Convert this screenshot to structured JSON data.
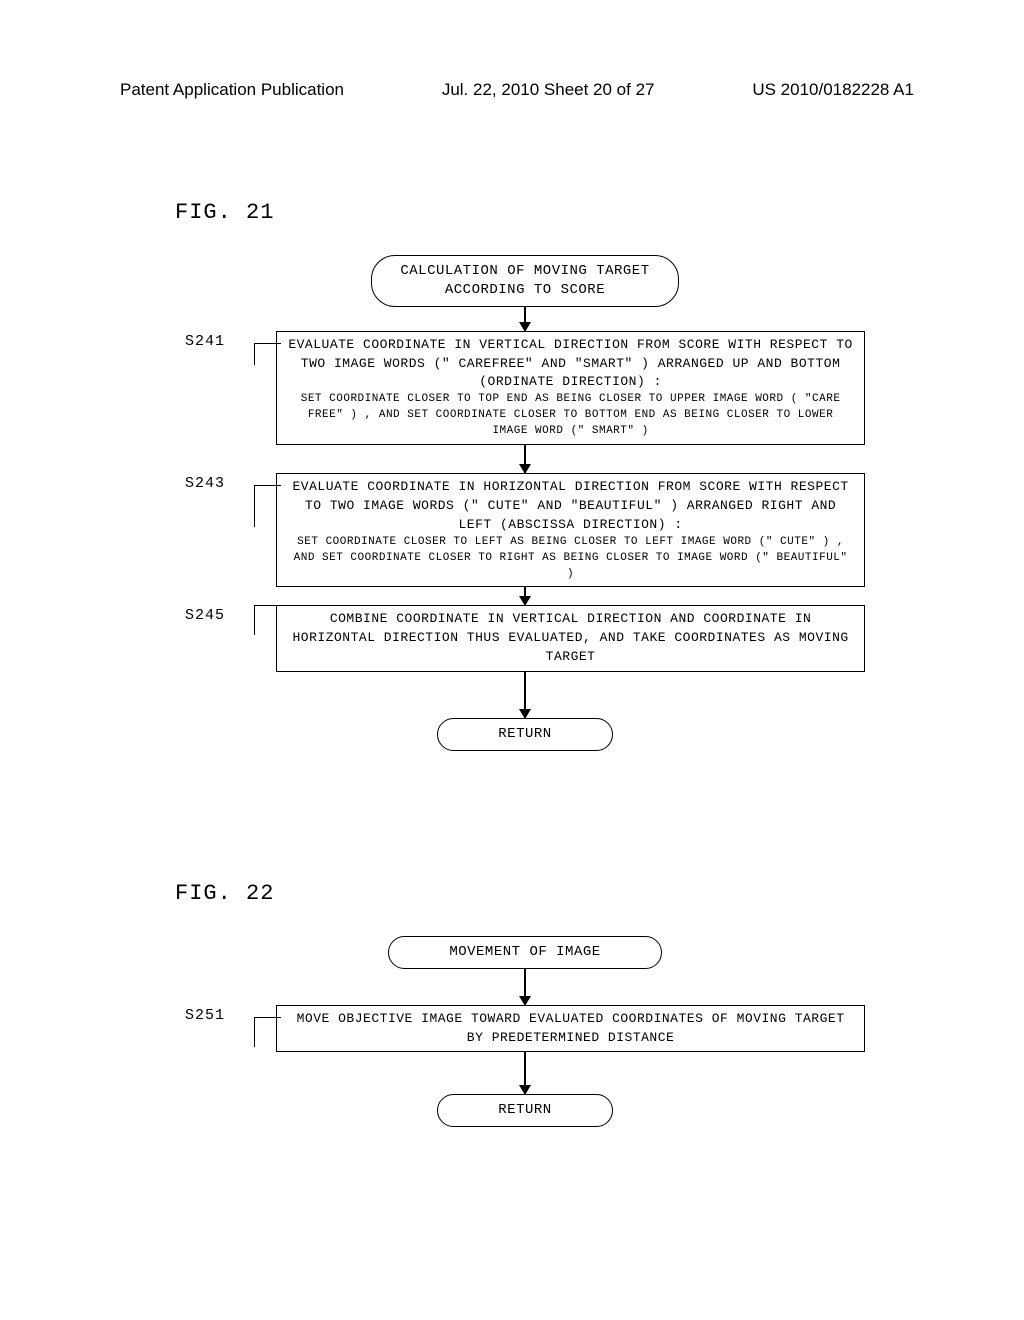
{
  "header": {
    "left": "Patent Application Publication",
    "center": "Jul. 22, 2010  Sheet 20 of 27",
    "right": "US 2010/0182228 A1"
  },
  "fig21": {
    "label": "FIG. 21",
    "start": "CALCULATION OF MOVING TARGET\nACCORDING TO SCORE",
    "steps": {
      "s241": {
        "num": "S241",
        "main": "EVALUATE COORDINATE IN VERTICAL DIRECTION FROM SCORE WITH RESPECT TO TWO IMAGE WORDS (\" CAREFREE\" AND \"SMART\" ) ARRANGED UP AND BOTTOM (ORDINATE DIRECTION) :",
        "sub": "SET COORDINATE CLOSER TO TOP END AS BEING CLOSER TO UPPER IMAGE WORD ( \"CARE FREE\" ) , AND SET COORDINATE CLOSER TO BOTTOM END AS BEING CLOSER TO LOWER IMAGE WORD (\" SMART\" )"
      },
      "s243": {
        "num": "S243",
        "main": "EVALUATE COORDINATE IN HORIZONTAL DIRECTION FROM SCORE WITH RESPECT TO TWO IMAGE WORDS (\" CUTE\" AND \"BEAUTIFUL\" ) ARRANGED RIGHT AND LEFT (ABSCISSA DIRECTION) :",
        "sub": "SET COORDINATE CLOSER TO LEFT AS BEING CLOSER TO LEFT IMAGE WORD (\" CUTE\" ) , AND SET COORDINATE CLOSER TO RIGHT AS BEING CLOSER TO IMAGE WORD (\" BEAUTIFUL\" )"
      },
      "s245": {
        "num": "S245",
        "main": "COMBINE COORDINATE IN VERTICAL DIRECTION AND COORDINATE IN HORIZONTAL DIRECTION THUS EVALUATED, AND TAKE COORDINATES AS MOVING TARGET"
      }
    },
    "return": "RETURN"
  },
  "fig22": {
    "label": "FIG. 22",
    "start": "MOVEMENT OF IMAGE",
    "steps": {
      "s251": {
        "num": "S251",
        "main": "MOVE OBJECTIVE IMAGE TOWARD EVALUATED COORDINATES OF MOVING TARGET BY PREDETERMINED DISTANCE"
      }
    },
    "return": "RETURN"
  }
}
